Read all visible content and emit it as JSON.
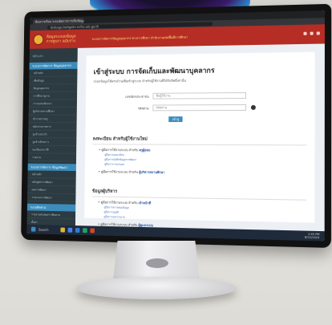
{
  "browser": {
    "tab_title": "ห้องการเรียน ระบบจัดการการเก็บข้อมูล",
    "url": "dsdusgo.hehgekn.ncfss.ssk.go.th"
  },
  "site": {
    "brand_line1": "ห้อมูลระบบบข้อมูล",
    "brand_line2": "การศูบรา ฉบับร่าง",
    "marquee": "ระบบการจัดการข้อมูลบุคลากร ทางการศึกษา สำนักงานเขตพื้นที่การศึกษา"
  },
  "sidebar": {
    "top": "หน้าแรก",
    "sections": [
      {
        "title": "ระบบการจัดการ ข้อมูลบุคลากร",
        "items": [
          "หน้าหลัก",
          "เพิ่มข้อมูล",
          "ข้อมูลบุคลากร",
          "การศึกษาดูงาน",
          "การอบรมสัมมนา",
          "ผู้บริหารสถานศึกษา",
          "ข้าราชการครู",
          "พนักงานราชการ",
          "ลูกจ้างประจำ",
          "ลูกจ้างชั่วคราว",
          "ทะเบียนประวัติ",
          "รายงาน"
        ]
      },
      {
        "title": "ระบบการจัดการ ข้อมูลพัฒนา",
        "items": [
          "หน้าหลัก",
          "หลักสูตรการพัฒนา",
          "ผลการพัฒนา",
          "รายงานการพัฒนา"
        ]
      },
      {
        "title": "ระบบติดตาม",
        "items": [
          "รายงานสรุปผลการติดตาม",
          "ตั้งค่า"
        ]
      }
    ]
  },
  "main": {
    "title": "เข้าสู่ระบบ การจัดเก็บและพัฒนาบุคลากร",
    "subtitle": "กรอกข้อมูลให้ครบถ้วนเพื่อเข้าสู่ระบบ สำหรับผู้ใช้งานที่ได้รับสิทธิ์เท่านั้น",
    "username_label": "เลขบัตรประชาชน",
    "username_placeholder": "ชื่อผู้ใช้งาน",
    "password_label": "รหัสผ่าน",
    "password_placeholder": "รหัสผ่าน",
    "login_button": "เข้าสู่ระบบ",
    "section1_title": "ลงทะเบียน สำหรับผู้ใช้งานใหม่",
    "section1_items": [
      {
        "head": "คู่มือการใช้งานระบบ สำหรับ",
        "bold": "ครูผู้สอน",
        "links": [
          "คู่มือการลงทะเบียน",
          "คู่มือการบันทึกข้อมูลการพัฒนา",
          "คู่มือการรายงานผล"
        ]
      },
      {
        "head": "คู่มือการใช้งานระบบ สำหรับ",
        "bold": "ผู้บริหารสถานศึกษา",
        "links": []
      }
    ],
    "section2_title": "ข้อมูลผู้บริหาร",
    "section2_items": [
      {
        "head": "คู่มือการใช้งานระบบ สำหรับ",
        "bold": "เจ้าหน้าที่",
        "links": [
          "คู่มือการตรวจสอบข้อมูล",
          "คู่มือการอนุมัติ",
          "คู่มือการออกรายงาน"
        ]
      },
      {
        "head": "คู่มือการใช้งานระบบ สำหรับ",
        "bold": "ผู้ดูแลระบบ",
        "links": []
      }
    ]
  },
  "taskbar": {
    "search_label": "Search",
    "time": "1:45 PM",
    "date": "6/12/2024"
  }
}
